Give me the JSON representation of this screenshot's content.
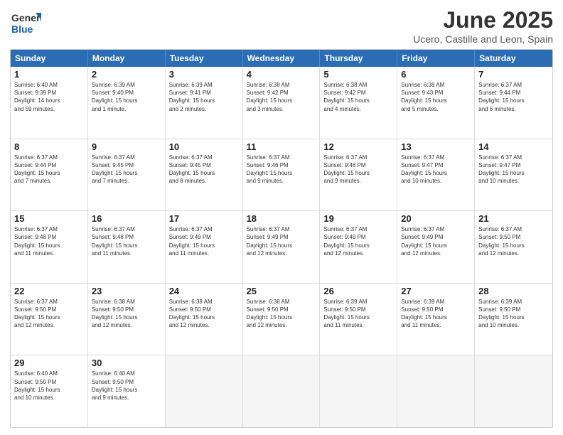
{
  "logo": {
    "line1": "General",
    "line2": "Blue"
  },
  "title": "June 2025",
  "subtitle": "Ucero, Castille and Leon, Spain",
  "headers": [
    "Sunday",
    "Monday",
    "Tuesday",
    "Wednesday",
    "Thursday",
    "Friday",
    "Saturday"
  ],
  "rows": [
    [
      {
        "day": "1",
        "lines": [
          "Sunrise: 6:40 AM",
          "Sunset: 9:39 PM",
          "Daylight: 14 hours",
          "and 59 minutes."
        ]
      },
      {
        "day": "2",
        "lines": [
          "Sunrise: 6:39 AM",
          "Sunset: 9:40 PM",
          "Daylight: 15 hours",
          "and 1 minute."
        ]
      },
      {
        "day": "3",
        "lines": [
          "Sunrise: 6:39 AM",
          "Sunset: 9:41 PM",
          "Daylight: 15 hours",
          "and 2 minutes."
        ]
      },
      {
        "day": "4",
        "lines": [
          "Sunrise: 6:38 AM",
          "Sunset: 9:42 PM",
          "Daylight: 15 hours",
          "and 3 minutes."
        ]
      },
      {
        "day": "5",
        "lines": [
          "Sunrise: 6:38 AM",
          "Sunset: 9:42 PM",
          "Daylight: 15 hours",
          "and 4 minutes."
        ]
      },
      {
        "day": "6",
        "lines": [
          "Sunrise: 6:38 AM",
          "Sunset: 9:43 PM",
          "Daylight: 15 hours",
          "and 5 minutes."
        ]
      },
      {
        "day": "7",
        "lines": [
          "Sunrise: 6:37 AM",
          "Sunset: 9:44 PM",
          "Daylight: 15 hours",
          "and 6 minutes."
        ]
      }
    ],
    [
      {
        "day": "8",
        "lines": [
          "Sunrise: 6:37 AM",
          "Sunset: 9:44 PM",
          "Daylight: 15 hours",
          "and 7 minutes."
        ]
      },
      {
        "day": "9",
        "lines": [
          "Sunrise: 6:37 AM",
          "Sunset: 9:45 PM",
          "Daylight: 15 hours",
          "and 7 minutes."
        ]
      },
      {
        "day": "10",
        "lines": [
          "Sunrise: 6:37 AM",
          "Sunset: 9:45 PM",
          "Daylight: 15 hours",
          "and 8 minutes."
        ]
      },
      {
        "day": "11",
        "lines": [
          "Sunrise: 6:37 AM",
          "Sunset: 9:46 PM",
          "Daylight: 15 hours",
          "and 9 minutes."
        ]
      },
      {
        "day": "12",
        "lines": [
          "Sunrise: 6:37 AM",
          "Sunset: 9:46 PM",
          "Daylight: 15 hours",
          "and 9 minutes."
        ]
      },
      {
        "day": "13",
        "lines": [
          "Sunrise: 6:37 AM",
          "Sunset: 9:47 PM",
          "Daylight: 15 hours",
          "and 10 minutes."
        ]
      },
      {
        "day": "14",
        "lines": [
          "Sunrise: 6:37 AM",
          "Sunset: 9:47 PM",
          "Daylight: 15 hours",
          "and 10 minutes."
        ]
      }
    ],
    [
      {
        "day": "15",
        "lines": [
          "Sunrise: 6:37 AM",
          "Sunset: 9:48 PM",
          "Daylight: 15 hours",
          "and 11 minutes."
        ]
      },
      {
        "day": "16",
        "lines": [
          "Sunrise: 6:37 AM",
          "Sunset: 9:48 PM",
          "Daylight: 15 hours",
          "and 11 minutes."
        ]
      },
      {
        "day": "17",
        "lines": [
          "Sunrise: 6:37 AM",
          "Sunset: 9:49 PM",
          "Daylight: 15 hours",
          "and 11 minutes."
        ]
      },
      {
        "day": "18",
        "lines": [
          "Sunrise: 6:37 AM",
          "Sunset: 9:49 PM",
          "Daylight: 15 hours",
          "and 12 minutes."
        ]
      },
      {
        "day": "19",
        "lines": [
          "Sunrise: 6:37 AM",
          "Sunset: 9:49 PM",
          "Daylight: 15 hours",
          "and 12 minutes."
        ]
      },
      {
        "day": "20",
        "lines": [
          "Sunrise: 6:37 AM",
          "Sunset: 9:49 PM",
          "Daylight: 15 hours",
          "and 12 minutes."
        ]
      },
      {
        "day": "21",
        "lines": [
          "Sunrise: 6:37 AM",
          "Sunset: 9:50 PM",
          "Daylight: 15 hours",
          "and 12 minutes."
        ]
      }
    ],
    [
      {
        "day": "22",
        "lines": [
          "Sunrise: 6:37 AM",
          "Sunset: 9:50 PM",
          "Daylight: 15 hours",
          "and 12 minutes."
        ]
      },
      {
        "day": "23",
        "lines": [
          "Sunrise: 6:38 AM",
          "Sunset: 9:50 PM",
          "Daylight: 15 hours",
          "and 12 minutes."
        ]
      },
      {
        "day": "24",
        "lines": [
          "Sunrise: 6:38 AM",
          "Sunset: 9:50 PM",
          "Daylight: 15 hours",
          "and 12 minutes."
        ]
      },
      {
        "day": "25",
        "lines": [
          "Sunrise: 6:38 AM",
          "Sunset: 9:50 PM",
          "Daylight: 15 hours",
          "and 12 minutes."
        ]
      },
      {
        "day": "26",
        "lines": [
          "Sunrise: 6:39 AM",
          "Sunset: 9:50 PM",
          "Daylight: 15 hours",
          "and 11 minutes."
        ]
      },
      {
        "day": "27",
        "lines": [
          "Sunrise: 6:39 AM",
          "Sunset: 9:50 PM",
          "Daylight: 15 hours",
          "and 11 minutes."
        ]
      },
      {
        "day": "28",
        "lines": [
          "Sunrise: 6:39 AM",
          "Sunset: 9:50 PM",
          "Daylight: 15 hours",
          "and 10 minutes."
        ]
      }
    ],
    [
      {
        "day": "29",
        "lines": [
          "Sunrise: 6:40 AM",
          "Sunset: 9:50 PM",
          "Daylight: 15 hours",
          "and 10 minutes."
        ]
      },
      {
        "day": "30",
        "lines": [
          "Sunrise: 6:40 AM",
          "Sunset: 9:50 PM",
          "Daylight: 15 hours",
          "and 9 minutes."
        ]
      },
      {
        "day": "",
        "lines": []
      },
      {
        "day": "",
        "lines": []
      },
      {
        "day": "",
        "lines": []
      },
      {
        "day": "",
        "lines": []
      },
      {
        "day": "",
        "lines": []
      }
    ]
  ]
}
